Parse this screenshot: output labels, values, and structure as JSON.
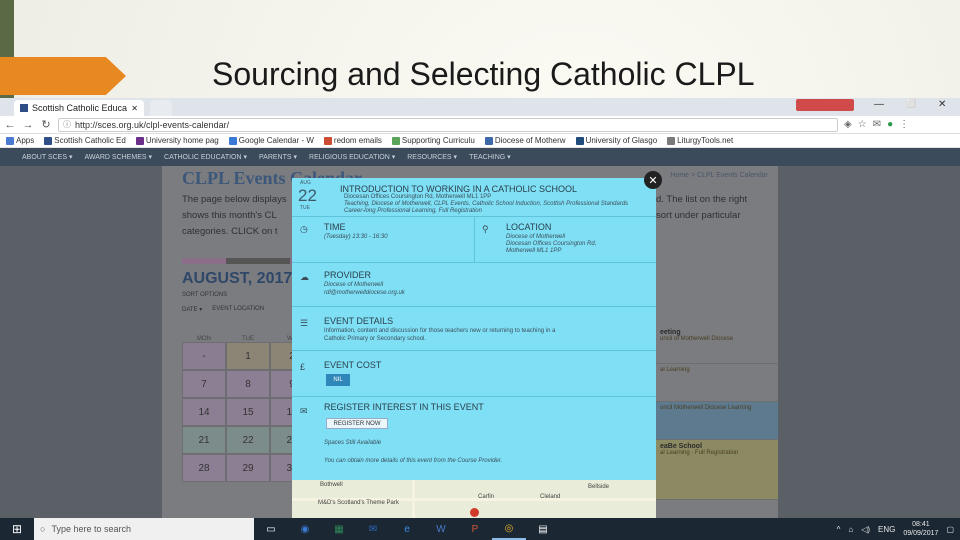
{
  "slide": {
    "title": "Sourcing and Selecting Catholic CLPL"
  },
  "browser": {
    "tab_title": "Scottish Catholic Education",
    "window_controls": {
      "minimize": "—",
      "maximize": "⬜",
      "close": "✕"
    },
    "profile_chip": "",
    "url": "http://sces.org.uk/clpl-events-calendar/",
    "bookmarks": [
      {
        "label": "Apps",
        "color": "#4a7ad1"
      },
      {
        "label": "Scottish Catholic Ed",
        "color": "#2d4f86"
      },
      {
        "label": "University home pag",
        "color": "#6b2f8a"
      },
      {
        "label": "Google Calendar - W",
        "color": "#3a78d6"
      },
      {
        "label": "redom emails",
        "color": "#cc4b33"
      },
      {
        "label": "Supporting Curriculu",
        "color": "#5aa55a"
      },
      {
        "label": "Diocese of Motherw",
        "color": "#3c68a8"
      },
      {
        "label": "University of Glasgo",
        "color": "#1f4c7a"
      },
      {
        "label": "LiturgyTools.net",
        "color": "#7a7a7a"
      }
    ]
  },
  "site": {
    "nav": [
      "About SCES ▾",
      "Award Schemes ▾",
      "Catholic Education ▾",
      "Parents ▾",
      "Religious Education ▾",
      "Resources ▾",
      "Teaching ▾"
    ],
    "page_heading": "CLPL Events Calendar",
    "breadcrumb": "Home > CLPL Events Calendar",
    "intro_lines": [
      "The page below displays",
      "shows this month's CL",
      "categories. CLICK on t"
    ],
    "intro_right": [
      "d. The list on the right",
      "sort under particular"
    ],
    "month_title": "AUGUST, 2017",
    "sort_label": "SORT OPTIONS",
    "sort_options": [
      "DATE ▾",
      "EVENT LOCATION"
    ],
    "calendar": {
      "headers": [
        "MON",
        "TUE",
        "WE"
      ],
      "rows": [
        [
          "-",
          "1",
          "2"
        ],
        [
          "7",
          "8",
          "9"
        ],
        [
          "14",
          "15",
          "16"
        ],
        [
          "21",
          "22",
          "23"
        ],
        [
          "28",
          "29",
          "30"
        ]
      ]
    },
    "right_events": [
      {
        "title": "eeting",
        "text": "uncil of Motherwell Diocese"
      },
      {
        "title": "",
        "text": "al Learning"
      },
      {
        "title": "",
        "text": "oncil Motherwell Diocese Learning"
      },
      {
        "title": "eaBe School",
        "text": "al Learning · Full Registration"
      }
    ]
  },
  "modal": {
    "close_symbol": "✕",
    "date_month": "AUG",
    "date_day": "22",
    "date_weekday": "TUE",
    "title": "Introduction to Working in a Catholic School",
    "location_line": "Diocesan Offices Coursington Rd, Motherwell ML1 1PP",
    "categories_line": "Teaching, Diocese of Motherwell, CLPL Events, Catholic School Induction, Scottish Professional Standards",
    "tags_line": "Career-long Professional Learning, Full Registration",
    "time": {
      "label": "TIME",
      "value": "(Tuesday) 13:30 - 16:30"
    },
    "location": {
      "label": "LOCATION",
      "lines": [
        "Diocese of Motherwell",
        "Diocesan Offices Coursington Rd,",
        "Motherwell ML1 1PP"
      ]
    },
    "provider": {
      "label": "PROVIDER",
      "name": "Diocese of Motherwell",
      "email": "rdl@motherwelldiocese.org.uk"
    },
    "details": {
      "label": "EVENT DETAILS",
      "lines": [
        "Information, content and discussion for those teachers new or returning to teaching in a",
        "Catholic Primary or Secondary school."
      ]
    },
    "cost": {
      "label": "EVENT COST",
      "value": "NIL"
    },
    "register": {
      "label": "REGISTER INTEREST IN THIS EVENT",
      "button": "REGISTER NOW",
      "spaces": "Spaces Still Available",
      "note": "You can obtain more details of this event from the Course Provider."
    },
    "map_labels": [
      "Bothwell",
      "M&D's Scotland's Theme Park",
      "Carfin",
      "Cleland",
      "Bellside"
    ]
  },
  "taskbar": {
    "search_placeholder": "Type here to search",
    "tray_lang": "ENG",
    "clock_time": "08:41",
    "clock_date": "09/09/2017"
  }
}
